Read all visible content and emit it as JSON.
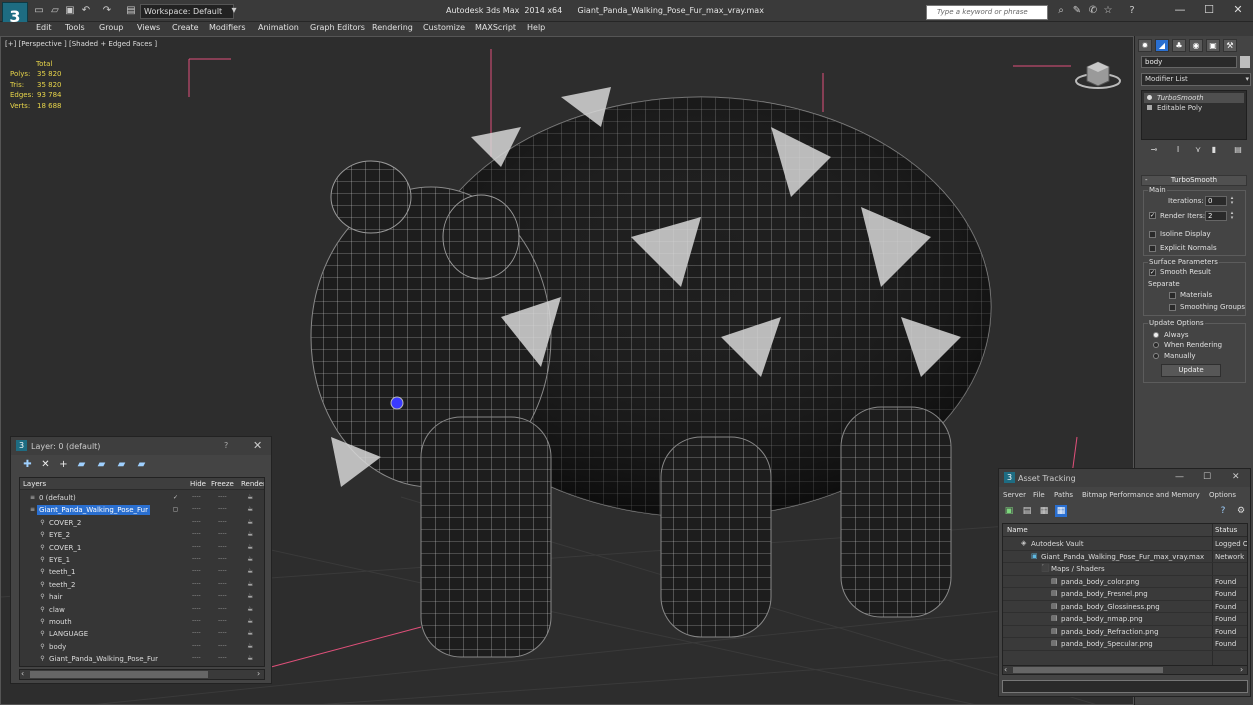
{
  "titlebar": {
    "workspace_label": "Workspace: Default",
    "window_title": "Autodesk 3ds Max  2014 x64      Giant_Panda_Walking_Pose_Fur_max_vray.max",
    "search_placeholder": "Type a keyword or phrase",
    "minimize": "—",
    "maximize": "☐",
    "close": "✕"
  },
  "menubar": {
    "items": [
      "Edit",
      "Tools",
      "Group",
      "Views",
      "Create",
      "Modifiers",
      "Animation",
      "Graph Editors",
      "Rendering",
      "Customize",
      "MAXScript",
      "Help"
    ]
  },
  "viewport": {
    "label": "[+] [Perspective ] [Shaded + Edged Faces ]",
    "stats_header": "Total",
    "stats": [
      {
        "label": "Polys:",
        "value": "35 820"
      },
      {
        "label": "Tris:",
        "value": "35 820"
      },
      {
        "label": "Edges:",
        "value": "93 784"
      },
      {
        "label": "Verts:",
        "value": "18 688"
      }
    ]
  },
  "command_panel": {
    "object_name": "body",
    "modifier_list": "Modifier List",
    "stack": [
      "TurboSmooth",
      "Editable Poly"
    ],
    "rollout_title": "TurboSmooth",
    "main_group": "Main",
    "iterations_label": "Iterations:",
    "iterations_value": "0",
    "render_iters_label": "Render Iters:",
    "render_iters_value": "2",
    "isoline_display": "Isoline Display",
    "explicit_normals": "Explicit Normals",
    "surface_group": "Surface Parameters",
    "smooth_result": "Smooth Result",
    "separate": "Separate",
    "materials": "Materials",
    "smoothing_groups": "Smoothing Groups",
    "update_group": "Update Options",
    "always": "Always",
    "when_rendering": "When Rendering",
    "manually": "Manually",
    "update_button": "Update"
  },
  "layer_panel": {
    "title": "Layer: 0 (default)",
    "help": "?",
    "close": "✕",
    "columns": {
      "layers": "Layers",
      "hide": "Hide",
      "freeze": "Freeze",
      "render": "Render"
    },
    "rows": [
      {
        "name": "0 (default)",
        "level": 0
      },
      {
        "name": "Giant_Panda_Walking_Pose_Fur",
        "level": 0
      },
      {
        "name": "COVER_2",
        "level": 1
      },
      {
        "name": "EYE_2",
        "level": 1
      },
      {
        "name": "COVER_1",
        "level": 1
      },
      {
        "name": "EYE_1",
        "level": 1
      },
      {
        "name": "teeth_1",
        "level": 1
      },
      {
        "name": "teeth_2",
        "level": 1
      },
      {
        "name": "hair",
        "level": 1
      },
      {
        "name": "claw",
        "level": 1
      },
      {
        "name": "mouth",
        "level": 1
      },
      {
        "name": "LANGUAGE",
        "level": 1
      },
      {
        "name": "body",
        "level": 1
      },
      {
        "name": "Giant_Panda_Walking_Pose_Fur",
        "level": 1
      }
    ],
    "dash": "----"
  },
  "asset_panel": {
    "title": "Asset Tracking",
    "menu": [
      "Server",
      "File",
      "Paths",
      "Bitmap Performance and Memory",
      "Options"
    ],
    "columns": {
      "name": "Name",
      "status": "Status"
    },
    "rows": [
      {
        "name": "Autodesk Vault",
        "status": "Logged O",
        "level": 1
      },
      {
        "name": "Giant_Panda_Walking_Pose_Fur_max_vray.max",
        "status": "Network P",
        "level": 2
      },
      {
        "name": "Maps / Shaders",
        "status": "",
        "level": 3
      },
      {
        "name": "panda_body_color.png",
        "status": "Found",
        "level": 4
      },
      {
        "name": "panda_body_Fresnel.png",
        "status": "Found",
        "level": 4
      },
      {
        "name": "panda_body_Glossiness.png",
        "status": "Found",
        "level": 4
      },
      {
        "name": "panda_body_nmap.png",
        "status": "Found",
        "level": 4
      },
      {
        "name": "panda_body_Refraction.png",
        "status": "Found",
        "level": 4
      },
      {
        "name": "panda_body_Specular.png",
        "status": "Found",
        "level": 4
      }
    ]
  },
  "colors": {
    "accent": "#2a6fd0",
    "stats_text": "#e8d54a",
    "selection_bracket": "#e0507a"
  }
}
